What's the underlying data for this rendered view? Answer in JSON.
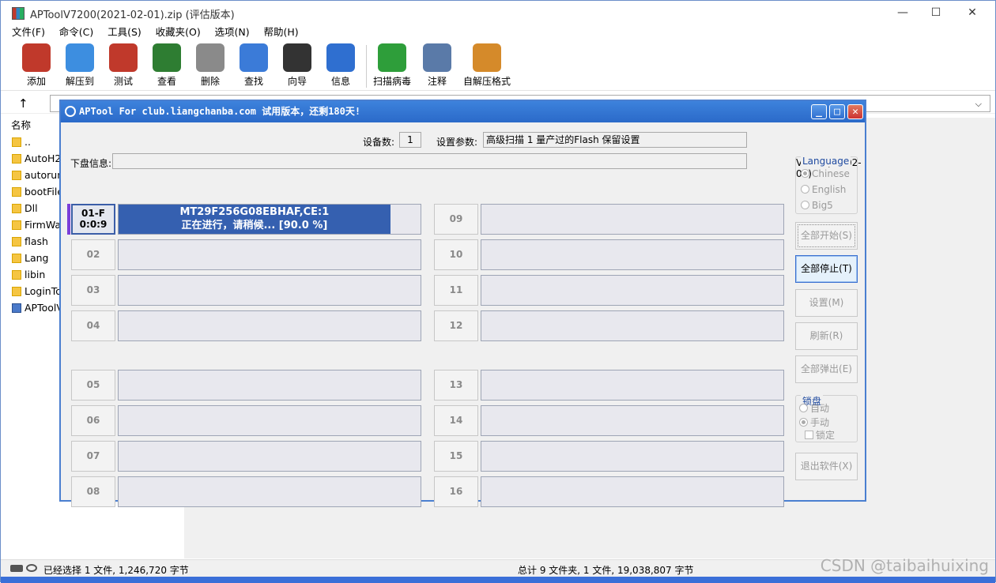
{
  "window": {
    "title": "APToolV7200(2021-02-01).zip (评估版本)",
    "controls": [
      "—",
      "☐",
      "✕"
    ]
  },
  "menu": [
    "文件(F)",
    "命令(C)",
    "工具(S)",
    "收藏夹(O)",
    "选项(N)",
    "帮助(H)"
  ],
  "toolbar": [
    {
      "label": "添加",
      "icon": "archive-add-icon",
      "color": "#c0392b"
    },
    {
      "label": "解压到",
      "icon": "folder-extract-icon",
      "color": "#3d8ee0"
    },
    {
      "label": "测试",
      "icon": "clipboard-test-icon",
      "color": "#c0392b"
    },
    {
      "label": "查看",
      "icon": "book-view-icon",
      "color": "#2e7d32"
    },
    {
      "label": "删除",
      "icon": "trash-icon",
      "color": "#8a8a8a"
    },
    {
      "label": "查找",
      "icon": "magnifier-icon",
      "color": "#3b7bd8"
    },
    {
      "label": "向导",
      "icon": "magic-wand-icon",
      "color": "#333333"
    },
    {
      "label": "信息",
      "icon": "info-icon",
      "color": "#2f6fd0"
    },
    {
      "label": "扫描病毒",
      "icon": "bug-scan-icon",
      "color": "#2e9e3a"
    },
    {
      "label": "注释",
      "icon": "comment-icon",
      "color": "#5a7aa8"
    },
    {
      "label": "自解压格式",
      "icon": "sfx-box-icon",
      "color": "#d58a2a"
    }
  ],
  "address": {
    "up": "↑",
    "dropdown": "⌵"
  },
  "filelist": {
    "header": "名称",
    "items": [
      {
        "name": "..",
        "type": "folder"
      },
      {
        "name": "AutoH2",
        "type": "folder"
      },
      {
        "name": "autorun",
        "type": "folder"
      },
      {
        "name": "bootFile",
        "type": "folder"
      },
      {
        "name": "Dll",
        "type": "folder"
      },
      {
        "name": "FirmWa",
        "type": "folder"
      },
      {
        "name": "flash",
        "type": "folder"
      },
      {
        "name": "Lang",
        "type": "folder"
      },
      {
        "name": "libin",
        "type": "folder"
      },
      {
        "name": "LoginTo",
        "type": "folder"
      },
      {
        "name": "APToolV",
        "type": "exe"
      }
    ]
  },
  "status": {
    "left": "已经选择 1 文件, 1,246,720 字节",
    "right": "总计 9 文件夹, 1 文件, 19,038,807 字节"
  },
  "watermark": "CSDN @taibaihuixing",
  "dialog": {
    "title": "APTool For club.liangchanba.com  试用版本，还剩180天!",
    "device_count_label": "设备数:",
    "device_count": "1",
    "settings_label": "设置参数:",
    "settings_value": "高级扫描 1 量产过的Flash 保留设置",
    "disk_info_label": "下盘信息:",
    "disk_info_value": "",
    "version": "V7200(21-02-01)",
    "active_slot": {
      "id": "01-F",
      "timer": "0:0:9",
      "line1": "MT29F256G08EBHAF,CE:1",
      "line2": "正在进行，请稍候... [90.0 %]",
      "progress": 0.9
    },
    "slots_left": [
      "02",
      "03",
      "04",
      "05",
      "06",
      "07",
      "08"
    ],
    "slots_right": [
      "09",
      "10",
      "11",
      "12",
      "13",
      "14",
      "15",
      "16"
    ],
    "language": {
      "title": "Language",
      "options": [
        "Chinese",
        "English",
        "Big5"
      ],
      "selected": "Chinese"
    },
    "buttons": {
      "start_all": "全部开始(S)",
      "stop_all": "全部停止(T)",
      "settings": "设置(M)",
      "refresh": "刷新(R)",
      "eject_all": "全部弹出(E)",
      "exit": "退出软件(X)"
    },
    "lock": {
      "title": "锁盘",
      "auto": "自动",
      "manual": "手动",
      "lock": "锁定",
      "selected": "手动"
    }
  }
}
